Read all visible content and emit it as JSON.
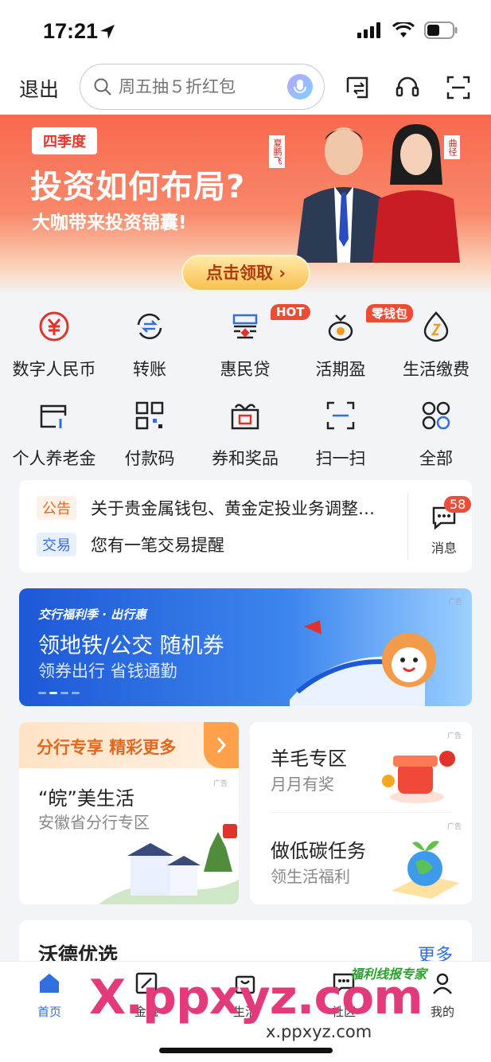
{
  "status": {
    "time": "17:21"
  },
  "topbar": {
    "exit": "退出",
    "search_placeholder": "周五抽５折红包"
  },
  "banner": {
    "season": "四季度",
    "headline": "投资如何布局?",
    "sub": "大咖带来投资锦囊!",
    "cta": "点击领取 ›",
    "name1": "夏鹏飞",
    "name2": "曲径"
  },
  "grid": [
    {
      "label": "数字人民币",
      "icon": "yuan-icon"
    },
    {
      "label": "转账",
      "icon": "transfer-icon"
    },
    {
      "label": "惠民贷",
      "icon": "loan-icon",
      "tag": "HOT"
    },
    {
      "label": "活期盈",
      "icon": "coin-bag-icon",
      "tag": "零钱包"
    },
    {
      "label": "生活缴费",
      "icon": "flame-icon"
    },
    {
      "label": "个人养老金",
      "icon": "card-icon"
    },
    {
      "label": "付款码",
      "icon": "qr-icon"
    },
    {
      "label": "券和奖品",
      "icon": "gift-icon"
    },
    {
      "label": "扫一扫",
      "icon": "scan-icon"
    },
    {
      "label": "全部",
      "icon": "all-icon"
    }
  ],
  "notice": {
    "tag1": "公告",
    "text1": "关于贵金属钱包、黄金定投业务调整的公告",
    "tag2": "交易",
    "text2": "您有一笔交易提醒",
    "msg_label": "消息",
    "msg_count": "58"
  },
  "promo": {
    "tagline": "交行福利季 · 出行惠",
    "title": "领地铁/公交 随机券",
    "sub": "领券出行 省钱通勤",
    "ad": "广告"
  },
  "cardL": {
    "head": "分行专享 精彩更多",
    "t1": "“皖”美生活",
    "t2": "安徽省分行专区",
    "ad": "广告"
  },
  "cardR": {
    "t1a": "羊毛专区",
    "t2a": "月月有奖",
    "t1b": "做低碳任务",
    "t2b": "领生活福利",
    "ad": "广告"
  },
  "wcard": {
    "title": "沃德优选",
    "more": "更多"
  },
  "tabs": [
    {
      "label": "首页",
      "icon": "home-icon",
      "active": true
    },
    {
      "label": "金融",
      "icon": "finance-icon"
    },
    {
      "label": "生活",
      "icon": "bag-icon"
    },
    {
      "label": "社区",
      "icon": "chat-icon"
    },
    {
      "label": "我的",
      "icon": "user-icon"
    }
  ],
  "watermark": {
    "main": "X.ppxyz.com",
    "small": "x.ppxyz.com",
    "green": "福利线报专家"
  },
  "colors": {
    "accent": "#2f6fe0",
    "red": "#e8372d",
    "orange": "#e2671f"
  }
}
